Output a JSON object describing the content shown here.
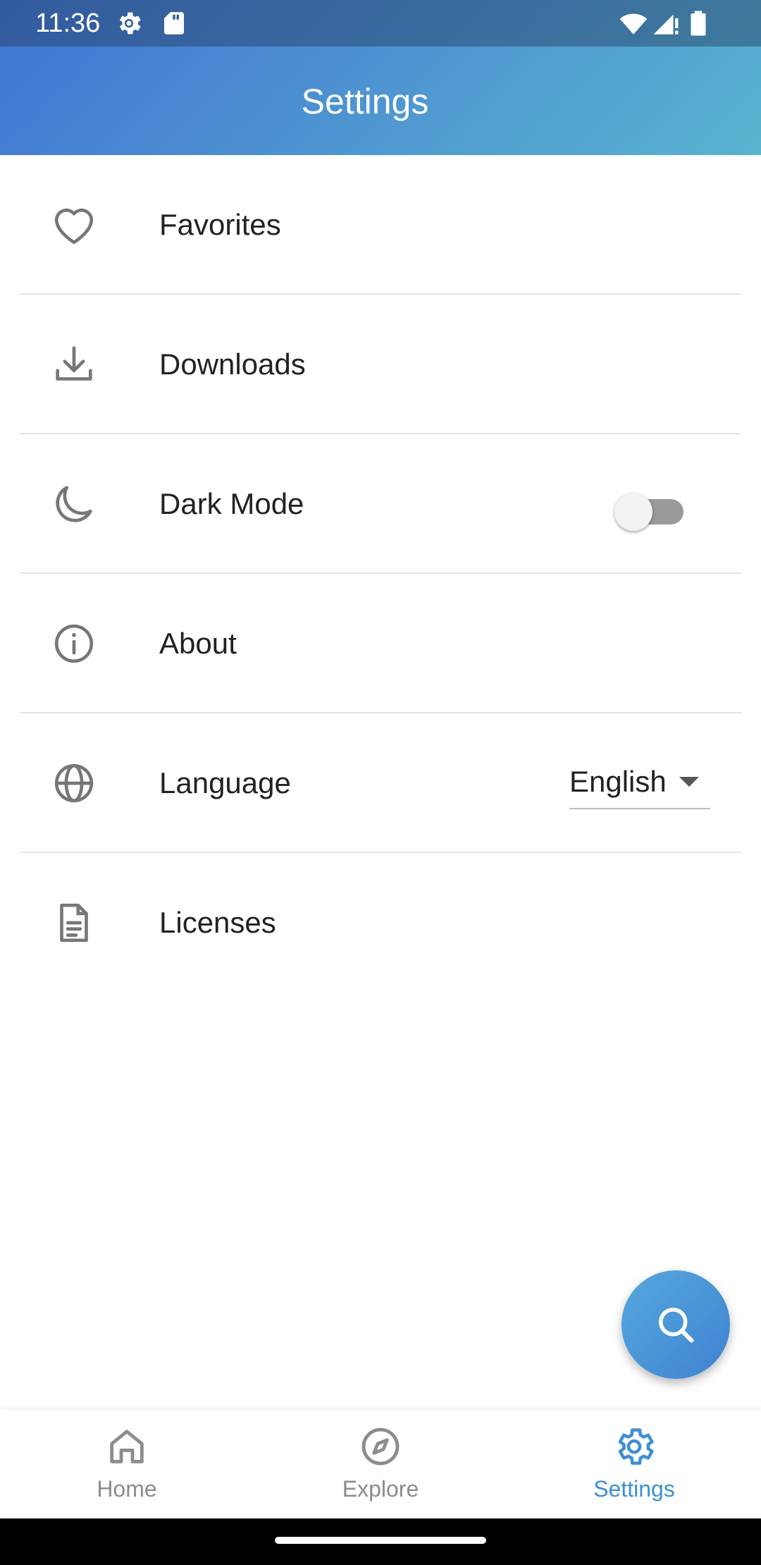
{
  "status_bar": {
    "time": "11:36",
    "icons": [
      "settings-gear-icon",
      "sd-card-icon",
      "wifi-icon",
      "cell-signal-icon",
      "battery-icon"
    ]
  },
  "app_bar": {
    "title": "Settings"
  },
  "settings": {
    "items": [
      {
        "label": "Favorites",
        "icon": "heart-icon"
      },
      {
        "label": "Downloads",
        "icon": "download-icon"
      },
      {
        "label": "Dark Mode",
        "icon": "moon-icon",
        "toggle_on": false
      },
      {
        "label": "About",
        "icon": "info-icon"
      },
      {
        "label": "Language",
        "icon": "globe-icon",
        "value": "English"
      },
      {
        "label": "Licenses",
        "icon": "document-icon"
      }
    ]
  },
  "fab": {
    "icon": "search-icon"
  },
  "bottom_nav": {
    "items": [
      {
        "label": "Home",
        "icon": "home-icon",
        "active": false
      },
      {
        "label": "Explore",
        "icon": "compass-icon",
        "active": false
      },
      {
        "label": "Settings",
        "icon": "gear-icon",
        "active": true
      }
    ]
  },
  "colors": {
    "accent": "#3d8fd6",
    "header_start": "#3f74d3",
    "header_end": "#58b4cf",
    "icon_gray": "#777777",
    "nav_inactive": "#8c8c8c"
  }
}
